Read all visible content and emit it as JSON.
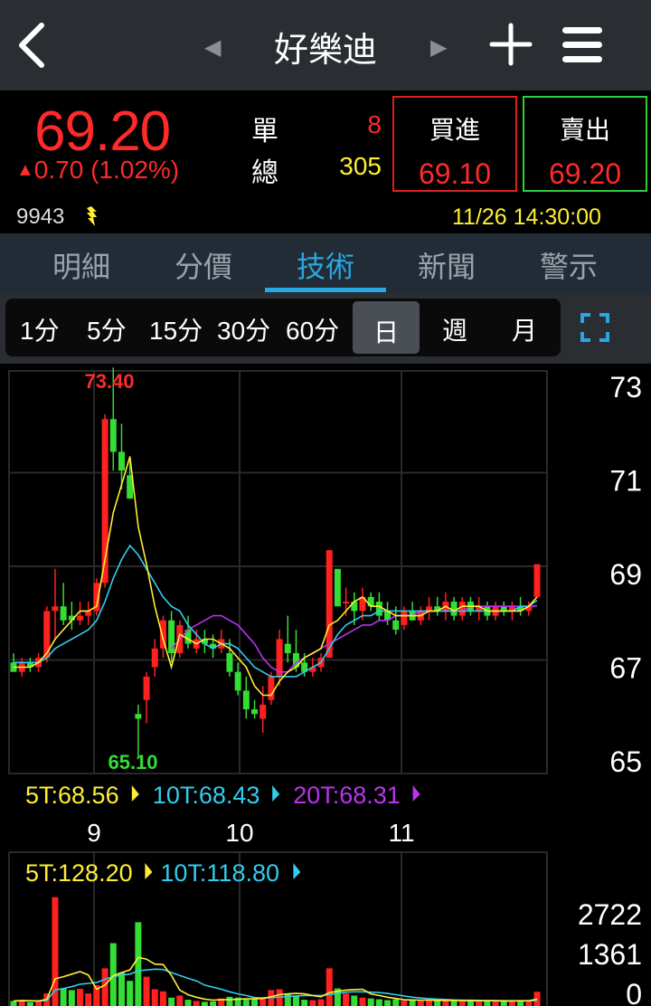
{
  "header": {
    "back_icon": "chevron-left-icon",
    "prev_icon": "triangle-left-icon",
    "next_icon": "triangle-right-icon",
    "title": "好樂迪",
    "add_icon": "plus-icon",
    "menu_icon": "hamburger-menu-icon"
  },
  "quote": {
    "price": "69.20",
    "change": "0.70 (1.02%)",
    "change_direction": "up",
    "single_label": "單",
    "single_value": "8",
    "total_label": "總",
    "total_value": "305",
    "buy_label": "買進",
    "buy_price": "69.10",
    "sell_label": "賣出",
    "sell_price": "69.20",
    "stock_code": "9943",
    "datetime": "11/26 14:30:00"
  },
  "tabs": [
    {
      "label": "明細",
      "active": false
    },
    {
      "label": "分價",
      "active": false
    },
    {
      "label": "技術",
      "active": true
    },
    {
      "label": "新聞",
      "active": false
    },
    {
      "label": "警示",
      "active": false
    }
  ],
  "periods": [
    {
      "label": "1分",
      "active": false
    },
    {
      "label": "5分",
      "active": false
    },
    {
      "label": "15分",
      "active": false
    },
    {
      "label": "30分",
      "active": false
    },
    {
      "label": "60分",
      "active": false
    },
    {
      "label": "日",
      "active": true
    },
    {
      "label": "週",
      "active": false
    },
    {
      "label": "月",
      "active": false
    }
  ],
  "colors": {
    "up": "#ff2020",
    "down": "#33dd33",
    "ma5": "#ffee33",
    "ma10": "#33ccee",
    "ma20": "#bb33ee",
    "accent": "#2aa6e0"
  },
  "chart_data": [
    {
      "type": "candlestick",
      "y_ticks": [
        "73",
        "71",
        "69",
        "67",
        "65"
      ],
      "ylim": [
        65,
        73.8
      ],
      "x_ticks": [
        "9",
        "10",
        "11"
      ],
      "high_label": "73.40",
      "low_label": "65.10",
      "ma_legend": [
        {
          "name": "5T",
          "value": "68.56"
        },
        {
          "name": "10T",
          "value": "68.43"
        },
        {
          "name": "20T",
          "value": "68.31"
        }
      ],
      "candles": [
        [
          67.1,
          67.3,
          66.9,
          66.9
        ],
        [
          66.9,
          67.2,
          66.8,
          67.1
        ],
        [
          67.1,
          67.2,
          66.9,
          67.0
        ],
        [
          67.0,
          67.3,
          66.9,
          67.2
        ],
        [
          67.2,
          68.3,
          67.1,
          68.2
        ],
        [
          68.2,
          69.1,
          67.6,
          68.3
        ],
        [
          68.3,
          68.8,
          67.9,
          68.0
        ],
        [
          68.1,
          68.4,
          67.8,
          68.0
        ],
        [
          68.0,
          68.4,
          67.9,
          68.1
        ],
        [
          68.1,
          68.4,
          67.9,
          68.2
        ],
        [
          68.2,
          68.9,
          68.1,
          68.8
        ],
        [
          68.8,
          72.4,
          68.7,
          72.3
        ],
        [
          72.3,
          73.4,
          71.2,
          71.6
        ],
        [
          71.6,
          72.2,
          70.8,
          71.2
        ],
        [
          71.1,
          71.4,
          70.6,
          70.6
        ],
        [
          66.0,
          66.2,
          65.1,
          65.9
        ],
        [
          66.3,
          66.9,
          65.8,
          66.8
        ],
        [
          67.0,
          67.6,
          66.8,
          67.4
        ],
        [
          67.4,
          68.1,
          67.2,
          68.0
        ],
        [
          68.0,
          68.2,
          67.1,
          67.3
        ],
        [
          67.3,
          68.0,
          67.2,
          67.9
        ],
        [
          67.8,
          68.1,
          67.4,
          67.5
        ],
        [
          67.4,
          67.8,
          67.3,
          67.6
        ],
        [
          67.6,
          67.8,
          67.3,
          67.5
        ],
        [
          67.5,
          67.7,
          67.2,
          67.4
        ],
        [
          67.4,
          67.8,
          67.3,
          67.6
        ],
        [
          67.3,
          67.6,
          66.8,
          66.9
        ],
        [
          66.9,
          67.1,
          66.4,
          66.5
        ],
        [
          66.5,
          66.8,
          65.9,
          66.1
        ],
        [
          66.1,
          66.3,
          65.9,
          66.0
        ],
        [
          65.9,
          66.6,
          65.6,
          66.2
        ],
        [
          66.3,
          66.9,
          66.2,
          66.8
        ],
        [
          66.8,
          67.8,
          66.6,
          67.6
        ],
        [
          67.5,
          68.1,
          67.1,
          67.3
        ],
        [
          67.3,
          67.8,
          66.9,
          67.0
        ],
        [
          67.1,
          67.3,
          66.8,
          66.9
        ],
        [
          66.9,
          67.2,
          66.8,
          67.0
        ],
        [
          67.0,
          67.3,
          66.9,
          67.2
        ],
        [
          67.2,
          69.5,
          67.2,
          69.5
        ],
        [
          69.1,
          69.1,
          68.3,
          68.3
        ],
        [
          68.4,
          68.7,
          68.1,
          68.4
        ],
        [
          68.4,
          68.6,
          67.9,
          68.2
        ],
        [
          68.2,
          68.7,
          68.0,
          68.5
        ],
        [
          68.5,
          68.6,
          68.2,
          68.3
        ],
        [
          68.4,
          68.6,
          68.0,
          68.1
        ],
        [
          68.2,
          68.4,
          67.9,
          68.0
        ],
        [
          68.0,
          68.3,
          67.7,
          67.8
        ],
        [
          67.9,
          68.3,
          67.8,
          68.2
        ],
        [
          68.2,
          68.4,
          68.0,
          68.0
        ],
        [
          68.0,
          68.3,
          67.9,
          68.2
        ],
        [
          68.2,
          68.5,
          68.0,
          68.3
        ],
        [
          68.3,
          68.5,
          68.1,
          68.2
        ],
        [
          68.2,
          68.6,
          68.0,
          68.4
        ],
        [
          68.4,
          68.5,
          68.0,
          68.1
        ],
        [
          68.1,
          68.5,
          68.0,
          68.4
        ],
        [
          68.4,
          68.5,
          68.1,
          68.2
        ],
        [
          68.2,
          68.5,
          68.0,
          68.3
        ],
        [
          68.3,
          68.4,
          68.0,
          68.1
        ],
        [
          68.1,
          68.4,
          68.0,
          68.3
        ],
        [
          68.3,
          68.4,
          68.1,
          68.2
        ],
        [
          68.2,
          68.4,
          68.0,
          68.3
        ],
        [
          68.3,
          68.5,
          68.1,
          68.2
        ],
        [
          68.2,
          68.4,
          68.1,
          68.3
        ],
        [
          68.5,
          69.2,
          68.5,
          69.2
        ]
      ],
      "ma5": [
        67.0,
        67.0,
        67.0,
        67.1,
        67.3,
        67.6,
        67.8,
        68.0,
        68.2,
        68.2,
        68.3,
        69.3,
        70.3,
        70.9,
        71.5,
        70.0,
        69.2,
        68.3,
        67.6,
        67.0,
        67.7,
        67.6,
        67.5,
        67.6,
        67.6,
        67.5,
        67.4,
        67.2,
        67.0,
        66.6,
        66.4,
        66.4,
        66.7,
        66.9,
        67.0,
        67.2,
        67.3,
        67.4,
        67.9,
        68.0,
        68.2,
        68.4,
        68.5,
        68.3,
        68.3,
        68.2,
        68.1,
        68.1,
        68.1,
        68.1,
        68.2,
        68.2,
        68.3,
        68.2,
        68.3,
        68.3,
        68.3,
        68.2,
        68.2,
        68.2,
        68.2,
        68.2,
        68.3,
        68.5
      ],
      "ma10": [
        67.1,
        67.1,
        67.1,
        67.1,
        67.2,
        67.4,
        67.5,
        67.6,
        67.7,
        67.8,
        68.0,
        68.4,
        68.9,
        69.3,
        69.6,
        69.4,
        69.1,
        68.8,
        68.5,
        68.3,
        68.2,
        67.9,
        67.7,
        67.5,
        67.4,
        67.5,
        67.5,
        67.4,
        67.2,
        67.0,
        66.9,
        66.8,
        66.8,
        66.8,
        66.8,
        66.9,
        67.0,
        67.1,
        67.4,
        67.7,
        67.9,
        68.0,
        68.1,
        68.1,
        68.2,
        68.2,
        68.2,
        68.2,
        68.2,
        68.2,
        68.2,
        68.2,
        68.2,
        68.2,
        68.2,
        68.2,
        68.2,
        68.2,
        68.2,
        68.2,
        68.2,
        68.3,
        68.3,
        68.43
      ],
      "ma20": [
        null,
        null,
        null,
        null,
        null,
        null,
        null,
        null,
        null,
        null,
        null,
        null,
        null,
        null,
        null,
        null,
        null,
        null,
        null,
        67.4,
        67.6,
        67.8,
        67.9,
        68.0,
        68.1,
        68.1,
        68.0,
        67.9,
        67.7,
        67.5,
        67.2,
        67.0,
        66.9,
        66.9,
        67.1,
        67.2,
        67.3,
        67.4,
        67.5,
        67.6,
        67.7,
        67.8,
        67.9,
        67.9,
        68.0,
        68.0,
        68.1,
        68.1,
        68.1,
        68.2,
        68.2,
        68.2,
        68.2,
        68.2,
        68.2,
        68.3,
        68.3,
        68.3,
        68.3,
        68.3,
        68.3,
        68.3,
        68.3,
        68.31
      ]
    },
    {
      "type": "bar",
      "y_ticks": [
        "2722",
        "1361",
        "0"
      ],
      "ylim": [
        0,
        2722
      ],
      "ma_legend": [
        {
          "name": "5T",
          "value": "128.20"
        },
        {
          "name": "10T",
          "value": "118.80"
        }
      ],
      "volumes": [
        120,
        150,
        90,
        110,
        300,
        2600,
        420,
        380,
        410,
        300,
        500,
        900,
        1500,
        800,
        600,
        2000,
        700,
        400,
        350,
        200,
        250,
        150,
        120,
        100,
        110,
        180,
        220,
        200,
        150,
        160,
        210,
        380,
        400,
        300,
        250,
        150,
        140,
        160,
        900,
        420,
        300,
        250,
        200,
        180,
        160,
        140,
        160,
        130,
        150,
        140,
        130,
        120,
        150,
        130,
        120,
        110,
        130,
        120,
        140,
        110,
        120,
        130,
        120,
        340
      ],
      "vol_ma5": [
        120,
        130,
        125,
        120,
        160,
        650,
        700,
        760,
        820,
        740,
        400,
        500,
        720,
        800,
        860,
        1160,
        1120,
        1000,
        990,
        730,
        380,
        270,
        210,
        165,
        140,
        150,
        150,
        160,
        170,
        170,
        180,
        220,
        270,
        290,
        300,
        290,
        250,
        220,
        320,
        350,
        380,
        390,
        400,
        290,
        250,
        210,
        180,
        150,
        145,
        140,
        140,
        135,
        135,
        135,
        130,
        125,
        125,
        125,
        125,
        122,
        122,
        125,
        125,
        164
      ],
      "vol_ma10": [
        120,
        125,
        120,
        120,
        135,
        380,
        420,
        460,
        520,
        540,
        560,
        640,
        700,
        740,
        760,
        840,
        860,
        880,
        870,
        800,
        730,
        660,
        600,
        500,
        450,
        400,
        340,
        290,
        250,
        200,
        190,
        200,
        210,
        230,
        240,
        250,
        250,
        250,
        270,
        300,
        330,
        340,
        340,
        330,
        320,
        300,
        270,
        240,
        210,
        190,
        175,
        165,
        155,
        145,
        140,
        138,
        135,
        132,
        130,
        128,
        126,
        126,
        124,
        128
      ]
    }
  ]
}
